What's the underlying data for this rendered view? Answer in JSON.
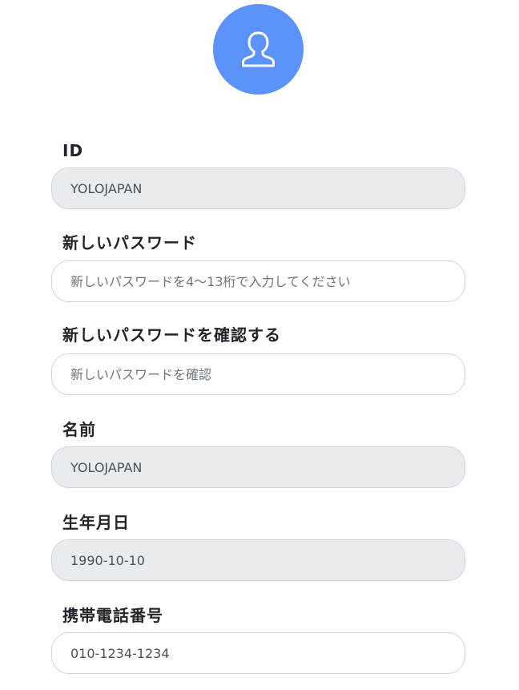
{
  "avatar": {
    "icon": "user-icon",
    "color": "#5b93fb"
  },
  "form": {
    "id": {
      "label": "ID",
      "value": "YOLOJAPAN"
    },
    "new_password": {
      "label": "新しいパスワード",
      "placeholder": "新しいパスワードを4〜13桁で入力してください"
    },
    "confirm_password": {
      "label": "新しいパスワードを確認する",
      "placeholder": "新しいパスワードを確認"
    },
    "name": {
      "label": "名前",
      "value": "YOLOJAPAN"
    },
    "birthday": {
      "label": "生年月日",
      "value": "1990-10-10"
    },
    "phone": {
      "label": "携帯電話番号",
      "value": "010-1234-1234"
    }
  },
  "colors": {
    "readonly_background": "#e9ecef",
    "border": "#ced4da",
    "text": "#212529",
    "accent": "#5b93fb"
  }
}
